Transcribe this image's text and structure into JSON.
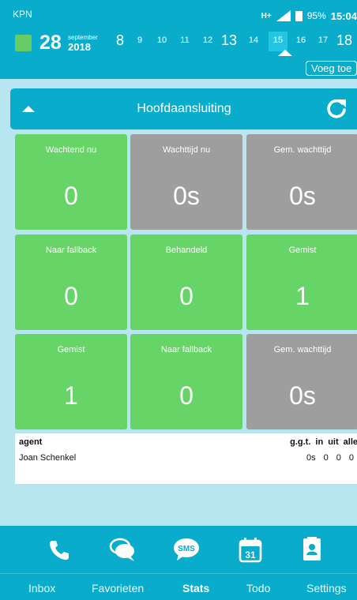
{
  "status_bar": {
    "carrier": "KPN",
    "network": "H+",
    "battery": "95%",
    "time": "15:04"
  },
  "date_bar": {
    "day": "28",
    "month": "september",
    "year": "2018",
    "days": [
      {
        "label": "8",
        "big": true
      },
      {
        "label": "9"
      },
      {
        "label": "10"
      },
      {
        "label": "11"
      },
      {
        "label": "12"
      },
      {
        "label": "13",
        "big": true
      },
      {
        "label": "14"
      },
      {
        "label": "15",
        "selected": true
      },
      {
        "label": "16"
      },
      {
        "label": "17"
      },
      {
        "label": "18",
        "big": true
      }
    ]
  },
  "add_button": "Voeg toe",
  "section": {
    "title": "Hoofdaansluiting"
  },
  "tiles": [
    {
      "label": "Wachtend nu",
      "value": "0",
      "color": "green"
    },
    {
      "label": "Wachttijd nu",
      "value": "0s",
      "color": "grey"
    },
    {
      "label": "Gem. wachttijd",
      "value": "0s",
      "color": "grey"
    },
    {
      "label": "Naar fallback",
      "value": "0",
      "color": "green"
    },
    {
      "label": "Behandeld",
      "value": "0",
      "color": "green"
    },
    {
      "label": "Gemist",
      "value": "1",
      "color": "green"
    },
    {
      "label": "Gemist",
      "value": "1",
      "color": "green"
    },
    {
      "label": "Naar fallback",
      "value": "0",
      "color": "green"
    },
    {
      "label": "Gem. wachttijd",
      "value": "0s",
      "color": "grey"
    }
  ],
  "agent_table": {
    "headers": {
      "agent": "agent",
      "ggt": "g.g.t.",
      "in": "in",
      "uit": "uit",
      "alle": "alle"
    },
    "rows": [
      {
        "name": "Joan Schenkel",
        "ggt": "0s",
        "in": "0",
        "uit": "0",
        "alle": "0"
      }
    ]
  },
  "bottom_icons": [
    {
      "icon": "phone-icon"
    },
    {
      "icon": "chat-icon"
    },
    {
      "icon": "sms-icon",
      "text": "SMS"
    },
    {
      "icon": "calendar-icon",
      "text": "31"
    },
    {
      "icon": "contact-icon"
    }
  ],
  "tabs": [
    {
      "label": "Inbox"
    },
    {
      "label": "Favorieten"
    },
    {
      "label": "Stats",
      "active": true
    },
    {
      "label": "Todo"
    },
    {
      "label": "Settings"
    }
  ],
  "colors": {
    "accent": "#0aaccc",
    "background": "#b7e5f0",
    "tile_green": "#66d466",
    "tile_grey": "#9e9e9e"
  }
}
